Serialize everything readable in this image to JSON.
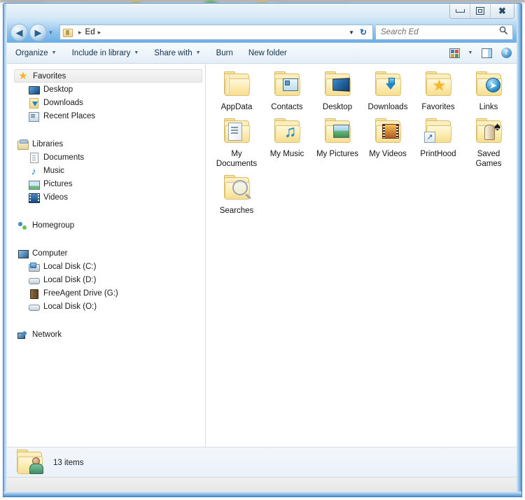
{
  "backdrop": {
    "note": "blurred browser window behind"
  },
  "window": {
    "caption": {
      "minimize_label": "Minimize",
      "restore_label": "Restore",
      "close_label": "Close"
    },
    "address_bar": {
      "back_label": "Back",
      "forward_label": "Forward",
      "breadcrumb": [
        "Ed"
      ],
      "separator": "▸",
      "dropdown": "▼",
      "refresh_label": "Refresh"
    },
    "search": {
      "placeholder": "Search Ed"
    },
    "toolbar": {
      "items": [
        {
          "label": "Organize",
          "caret": true
        },
        {
          "label": "Include in library",
          "caret": true
        },
        {
          "label": "Share with",
          "caret": true
        },
        {
          "label": "Burn",
          "caret": false
        },
        {
          "label": "New folder",
          "caret": false
        }
      ],
      "caret_glyph": "▼",
      "views_label": "Change your view",
      "views_caret": "▼",
      "preview_pane_label": "Show the preview pane",
      "help_label": "Get help",
      "help_glyph": "?"
    }
  },
  "sidebar": {
    "groups": [
      {
        "header": {
          "label": "Favorites",
          "icon": "star-icon",
          "selected": true
        },
        "items": [
          {
            "label": "Desktop",
            "icon": "desktop-icon"
          },
          {
            "label": "Downloads",
            "icon": "downloads-icon"
          },
          {
            "label": "Recent Places",
            "icon": "recent-places-icon"
          }
        ]
      },
      {
        "header": {
          "label": "Libraries",
          "icon": "libraries-icon",
          "selected": false
        },
        "items": [
          {
            "label": "Documents",
            "icon": "documents-icon"
          },
          {
            "label": "Music",
            "icon": "music-icon"
          },
          {
            "label": "Pictures",
            "icon": "pictures-icon"
          },
          {
            "label": "Videos",
            "icon": "videos-icon"
          }
        ]
      },
      {
        "header": {
          "label": "Homegroup",
          "icon": "homegroup-icon",
          "selected": false
        },
        "items": []
      },
      {
        "header": {
          "label": "Computer",
          "icon": "computer-icon",
          "selected": false
        },
        "items": [
          {
            "label": "Local Disk (C:)",
            "icon": "system-disk-icon"
          },
          {
            "label": "Local Disk (D:)",
            "icon": "disk-icon"
          },
          {
            "label": "FreeAgent Drive (G:)",
            "icon": "external-drive-icon"
          },
          {
            "label": "Local Disk (O:)",
            "icon": "disk-icon"
          }
        ]
      },
      {
        "header": {
          "label": "Network",
          "icon": "network-icon",
          "selected": false
        },
        "items": []
      }
    ]
  },
  "content": {
    "items": [
      {
        "label": "AppData",
        "icon": "folder-icon",
        "overlay": "none"
      },
      {
        "label": "Contacts",
        "icon": "folder-contacts-icon",
        "overlay": "contact-card"
      },
      {
        "label": "Desktop",
        "icon": "folder-desktop-icon",
        "overlay": "monitor"
      },
      {
        "label": "Downloads",
        "icon": "folder-downloads-icon",
        "overlay": "down-arrow"
      },
      {
        "label": "Favorites",
        "icon": "folder-favorites-icon",
        "overlay": "star"
      },
      {
        "label": "Links",
        "icon": "folder-links-icon",
        "overlay": "link-globe"
      },
      {
        "label": "My Documents",
        "icon": "folder-documents-icon",
        "overlay": "document"
      },
      {
        "label": "My Music",
        "icon": "folder-music-icon",
        "overlay": "music-note"
      },
      {
        "label": "My Pictures",
        "icon": "folder-pictures-icon",
        "overlay": "picture"
      },
      {
        "label": "My Videos",
        "icon": "folder-videos-icon",
        "overlay": "film"
      },
      {
        "label": "PrintHood",
        "icon": "folder-shortcut-icon",
        "overlay": "shortcut-arrow"
      },
      {
        "label": "Saved Games",
        "icon": "folder-games-icon",
        "overlay": "chess-spade"
      },
      {
        "label": "Searches",
        "icon": "folder-searches-icon",
        "overlay": "magnifier"
      }
    ]
  },
  "status": {
    "icon": "user-folder-icon",
    "text": "13 items"
  }
}
